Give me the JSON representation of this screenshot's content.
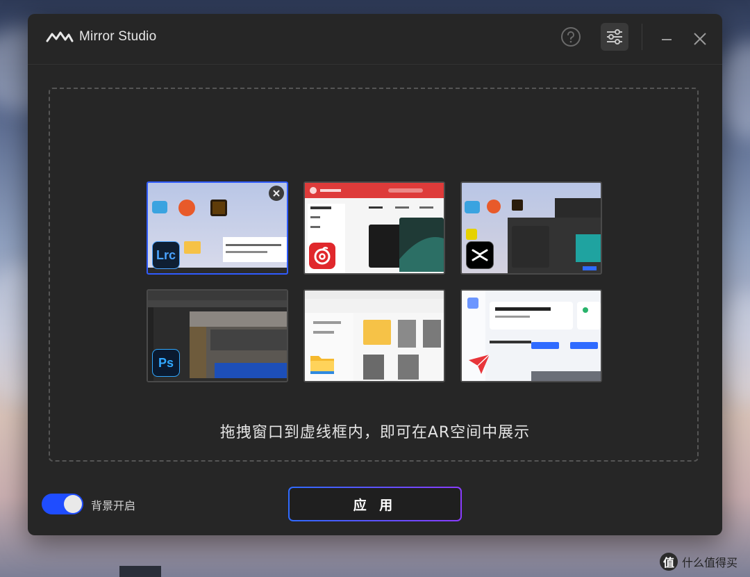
{
  "app": {
    "title": "Mirror Studio"
  },
  "dropzone": {
    "hint": "拖拽窗口到虚线框内，即可在AR空间中展示"
  },
  "thumbnails": [
    {
      "app_badge": "Lrc",
      "badge_icon": "lightroom-classic-icon",
      "badge_bg": "#0f1f33",
      "badge_fg": "#4aa3ff",
      "selected": true
    },
    {
      "app_badge": "",
      "badge_icon": "netease-music-icon",
      "badge_bg": "#e0282c",
      "badge_fg": "#ffffff",
      "selected": false
    },
    {
      "app_badge": "",
      "badge_icon": "capcut-icon",
      "badge_bg": "#000000",
      "badge_fg": "#ffffff",
      "selected": false
    },
    {
      "app_badge": "Ps",
      "badge_icon": "photoshop-icon",
      "badge_bg": "#0a1a30",
      "badge_fg": "#31a8ff",
      "selected": false
    },
    {
      "app_badge": "",
      "badge_icon": "file-explorer-icon",
      "badge_bg": "#f5b92e",
      "badge_fg": "#ffffff",
      "selected": false
    },
    {
      "app_badge": "",
      "badge_icon": "send-app-icon",
      "badge_bg": "#ffffff",
      "badge_fg": "#e8353a",
      "selected": false
    }
  ],
  "footer": {
    "background_toggle_label": "背景开启",
    "background_toggle_on": true,
    "apply_label": "应 用"
  },
  "watermark": {
    "logo": "值",
    "text": "什么值得买"
  },
  "colors": {
    "accent": "#1f4dff",
    "apply_gradient_start": "#2f6bff",
    "apply_gradient_end": "#8a3cff",
    "window_bg": "#262626"
  }
}
